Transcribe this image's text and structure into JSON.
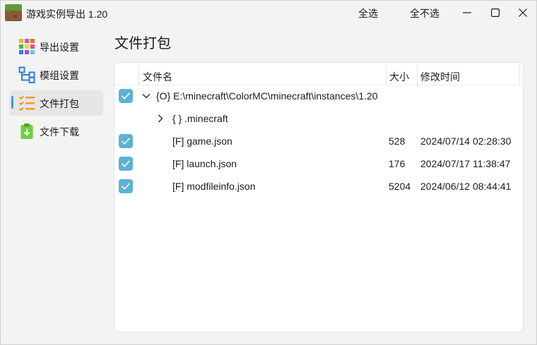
{
  "window": {
    "title": "游戏实例导出 1.20",
    "select_all": "全选",
    "select_none": "全不选"
  },
  "sidebar": {
    "items": [
      {
        "label": "导出设置",
        "icon": "color-grid-icon",
        "active": false
      },
      {
        "label": "模组设置",
        "icon": "tree-structure-icon",
        "active": false
      },
      {
        "label": "文件打包",
        "icon": "checklist-icon",
        "active": true
      },
      {
        "label": "文件下载",
        "icon": "clipboard-download-icon",
        "active": false
      }
    ]
  },
  "page": {
    "title": "文件打包"
  },
  "table": {
    "columns": [
      "文件名",
      "大小",
      "修改时间"
    ],
    "rows": [
      {
        "checked": true,
        "expander": "chevron-down",
        "name": "{O} E:\\minecraft\\ColorMC\\minecraft\\instances\\1.20",
        "size": "",
        "modified": ""
      },
      {
        "checked": false,
        "expander": "chevron-right",
        "name": "{ } .minecraft",
        "size": "",
        "modified": ""
      },
      {
        "checked": true,
        "expander": "",
        "name": "[F] game.json",
        "size": "528",
        "modified": "2024/07/14 02:28:30"
      },
      {
        "checked": true,
        "expander": "",
        "name": "[F] launch.json",
        "size": "176",
        "modified": "2024/07/17 11:38:47"
      },
      {
        "checked": true,
        "expander": "",
        "name": "[F] modfileinfo.json",
        "size": "5204",
        "modified": "2024/06/12 08:44:41"
      }
    ]
  },
  "colors": {
    "accent": "#5bb3d3",
    "indicator": "#3a9fd0"
  }
}
